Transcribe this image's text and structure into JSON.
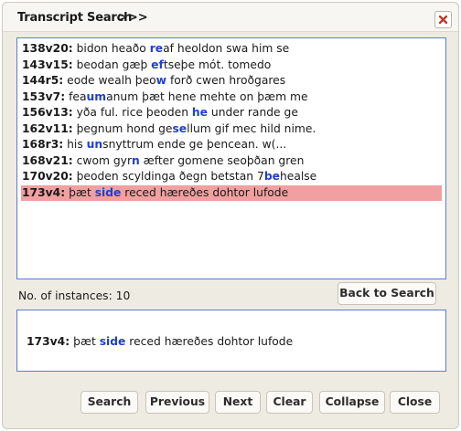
{
  "window": {
    "title": "Transcript Search",
    "toggle_label": ">>>"
  },
  "results": [
    {
      "ref": "138v20:",
      "parts": [
        {
          "t": " bidon heaðo "
        },
        {
          "t": "re",
          "h": true
        },
        {
          "t": "af heoldon swa him se"
        }
      ]
    },
    {
      "ref": "143v15:",
      "parts": [
        {
          "t": " beodan gæþ "
        },
        {
          "t": "ef",
          "h": true
        },
        {
          "t": "tseþe mót. tomedo"
        }
      ]
    },
    {
      "ref": "144r5:",
      "parts": [
        {
          "t": " eode wealh þeo"
        },
        {
          "t": "w",
          "h": true
        },
        {
          "t": " forð cwen hroðgares"
        }
      ]
    },
    {
      "ref": "153v7:",
      "parts": [
        {
          "t": " fea"
        },
        {
          "t": "um",
          "h": true
        },
        {
          "t": "anum þæt hene mehte on þæm me"
        }
      ]
    },
    {
      "ref": "156v13:",
      "parts": [
        {
          "t": " yða ful. rice þeoden "
        },
        {
          "t": "he",
          "h": true
        },
        {
          "t": " under rande ge"
        }
      ]
    },
    {
      "ref": "162v11:",
      "parts": [
        {
          "t": " þegnum hond ge"
        },
        {
          "t": "se",
          "h": true
        },
        {
          "t": "llum gif mec hild nime."
        }
      ]
    },
    {
      "ref": "168r3:",
      "parts": [
        {
          "t": " his "
        },
        {
          "t": "un",
          "h": true
        },
        {
          "t": "snyttrum ende ge þencean. w(..."
        }
      ]
    },
    {
      "ref": "168v21:",
      "parts": [
        {
          "t": " cwom gyr"
        },
        {
          "t": "n",
          "h": true
        },
        {
          "t": " æfter gomene seoþðan gren"
        }
      ]
    },
    {
      "ref": "170v20:",
      "parts": [
        {
          "t": " þeoden scyldinga ðegn betstan 7"
        },
        {
          "t": "be",
          "h": true
        },
        {
          "t": "healse"
        }
      ]
    },
    {
      "ref": "173v4:",
      "parts": [
        {
          "t": " þæt "
        },
        {
          "t": "side",
          "h": true
        },
        {
          "t": " reced hæreðes dohtor lufode"
        }
      ],
      "selected": true
    }
  ],
  "count_label": "No. of instances: 10",
  "back_to_search_label": "Back to Search",
  "detail": {
    "ref": "173v4:",
    "parts": [
      {
        "t": " þæt "
      },
      {
        "t": "side",
        "h": true
      },
      {
        "t": " reced hæreðes dohtor lufode"
      }
    ]
  },
  "buttons": {
    "search": "Search",
    "previous": "Previous",
    "next": "Next",
    "clear": "Clear",
    "collapse": "Collapse",
    "close": "Close"
  },
  "colors": {
    "highlight_text": "#1f3fcf",
    "selected_row": "#f0a0a0",
    "panel_border": "#5b7fd0",
    "close_icon": "#c0392b"
  },
  "icons": {
    "close": "close-x-icon"
  }
}
